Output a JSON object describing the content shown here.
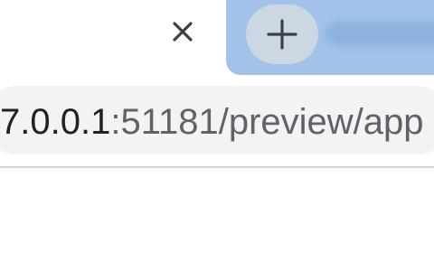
{
  "tabs": {
    "close_label": "×",
    "new_tab_label": "+"
  },
  "address_bar": {
    "host": "7.0.0.1",
    "rest": ":51181/preview/app"
  },
  "colors": {
    "inactive_tab_bg": "#a3c2ea",
    "new_tab_button_bg": "#cdd6e3",
    "omnibox_bg": "#f1f3f4",
    "separator": "#d4d4d4"
  }
}
